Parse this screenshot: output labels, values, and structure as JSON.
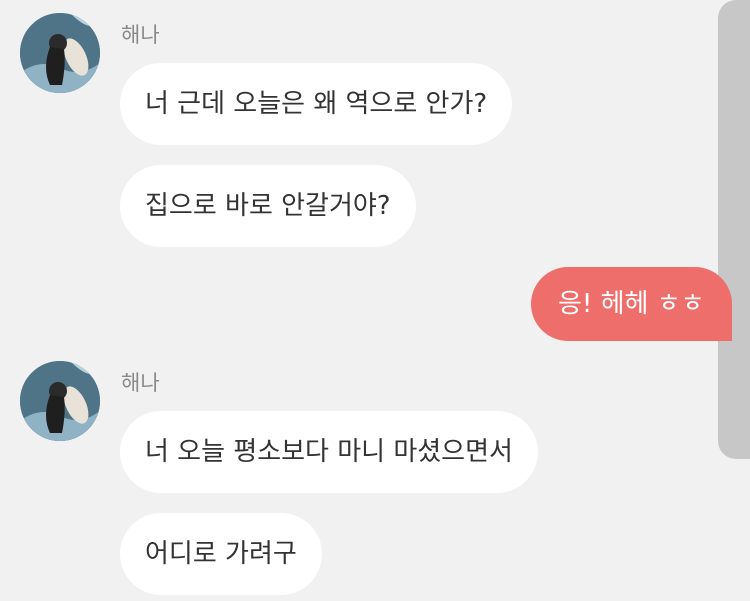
{
  "conversation": {
    "groups": [
      {
        "sender": "해나",
        "messages": [
          "너 근데 오늘은 왜 역으로 안가?",
          "집으로 바로 안갈거야?"
        ]
      },
      {
        "sender": "해나",
        "messages": [
          "너 오늘 평소보다 마니 마셨으면서",
          "어디로 가려구"
        ]
      }
    ],
    "my_messages": [
      "응! 헤헤 ㅎㅎ"
    ]
  },
  "colors": {
    "background": "#f1f1f1",
    "incoming_bubble": "#ffffff",
    "outgoing_bubble": "#ed6e6b",
    "sender_name": "#8a8a8a",
    "scrollbar": "#c7c7c7"
  },
  "icons": {
    "avatar": "profile-photo-avatar"
  }
}
